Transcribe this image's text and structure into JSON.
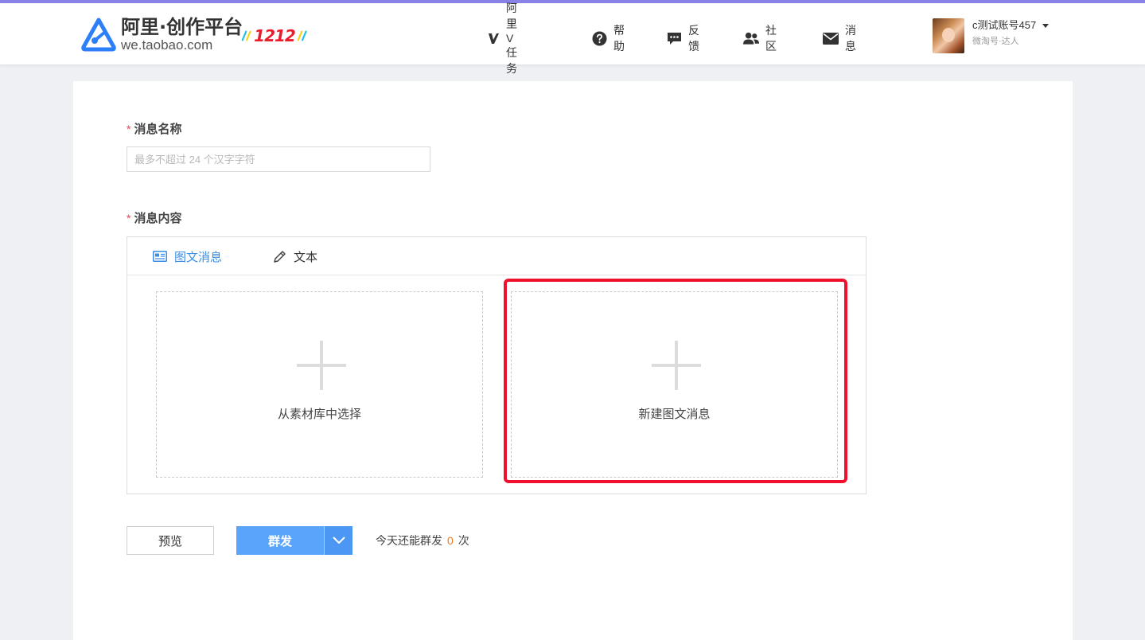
{
  "header": {
    "logo_title": "阿里·创作平台",
    "logo_subtitle": "we.taobao.com",
    "badge_text": "1212",
    "nav": [
      {
        "label": "阿里V任务",
        "icon": "v-icon"
      },
      {
        "label": "帮助",
        "icon": "help-circle-icon"
      },
      {
        "label": "反馈",
        "icon": "chat-bubble-icon"
      },
      {
        "label": "社区",
        "icon": "people-icon"
      },
      {
        "label": "消息",
        "icon": "envelope-icon"
      }
    ],
    "user": {
      "name": "c测试账号457",
      "role": "微淘号·达人"
    }
  },
  "form": {
    "name_label": "消息名称",
    "name_placeholder": "最多不超过 24 个汉字字符",
    "name_value": "",
    "content_label": "消息内容",
    "required_mark": "*",
    "tabs": [
      {
        "label": "图文消息",
        "icon": "image-card-icon",
        "active": true
      },
      {
        "label": "文本",
        "icon": "pencil-icon",
        "active": false
      }
    ],
    "cards": [
      {
        "label": "从素材库中选择",
        "icon": "plus-icon"
      },
      {
        "label": "新建图文消息",
        "icon": "plus-icon"
      }
    ]
  },
  "actions": {
    "preview_label": "预览",
    "send_label": "群发",
    "quota_prefix": "今天还能群发",
    "quota_count": "0",
    "quota_suffix": "次"
  },
  "colors": {
    "accent_top_bar": "#8a82e6",
    "primary_blue": "#5aa5fb",
    "active_tab": "#3a8ee6",
    "required": "#e7415a",
    "highlight": "#f0102e",
    "quota_count": "#f5781e"
  }
}
